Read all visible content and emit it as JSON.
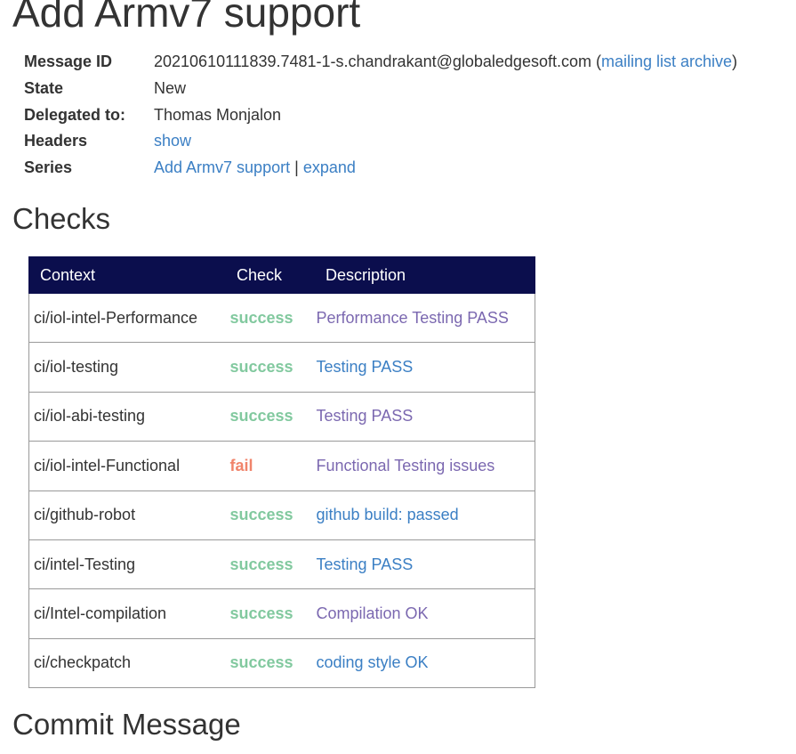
{
  "page": {
    "title": "Add Armv7 support"
  },
  "meta": {
    "message_id_label": "Message ID",
    "message_id": "20210610111839.7481-1-s.chandrakant@globaledgesoft.com",
    "archive_open": "(",
    "archive_link": "mailing list archive",
    "archive_close": ")",
    "state_label": "State",
    "state": "New",
    "delegated_label": "Delegated to:",
    "delegated": "Thomas Monjalon",
    "headers_label": "Headers",
    "headers_link": "show",
    "series_label": "Series",
    "series_link": "Add Armv7 support",
    "series_sep": "|",
    "series_expand": "expand"
  },
  "checks": {
    "heading": "Checks",
    "columns": [
      "Context",
      "Check",
      "Description"
    ],
    "rows": [
      {
        "context": "ci/iol-intel-Performance",
        "state": "success",
        "description": "Performance Testing PASS"
      },
      {
        "context": "ci/iol-testing",
        "state": "success",
        "description": "Testing PASS"
      },
      {
        "context": "ci/iol-abi-testing",
        "state": "success",
        "description": "Testing PASS"
      },
      {
        "context": "ci/iol-intel-Functional",
        "state": "fail",
        "description": "Functional Testing issues"
      },
      {
        "context": "ci/github-robot",
        "state": "success",
        "description": "github build: passed"
      },
      {
        "context": "ci/intel-Testing",
        "state": "success",
        "description": "Testing PASS"
      },
      {
        "context": "ci/Intel-compilation",
        "state": "success",
        "description": "Compilation OK"
      },
      {
        "context": "ci/checkpatch",
        "state": "success",
        "description": "coding style OK"
      }
    ]
  },
  "commit": {
    "heading": "Commit Message"
  },
  "colors": {
    "header_bg": "#0b0e4d",
    "link": "#3b7fc4",
    "link_visited": "#7b68b0",
    "success": "#82c99f",
    "fail": "#f0846b"
  }
}
